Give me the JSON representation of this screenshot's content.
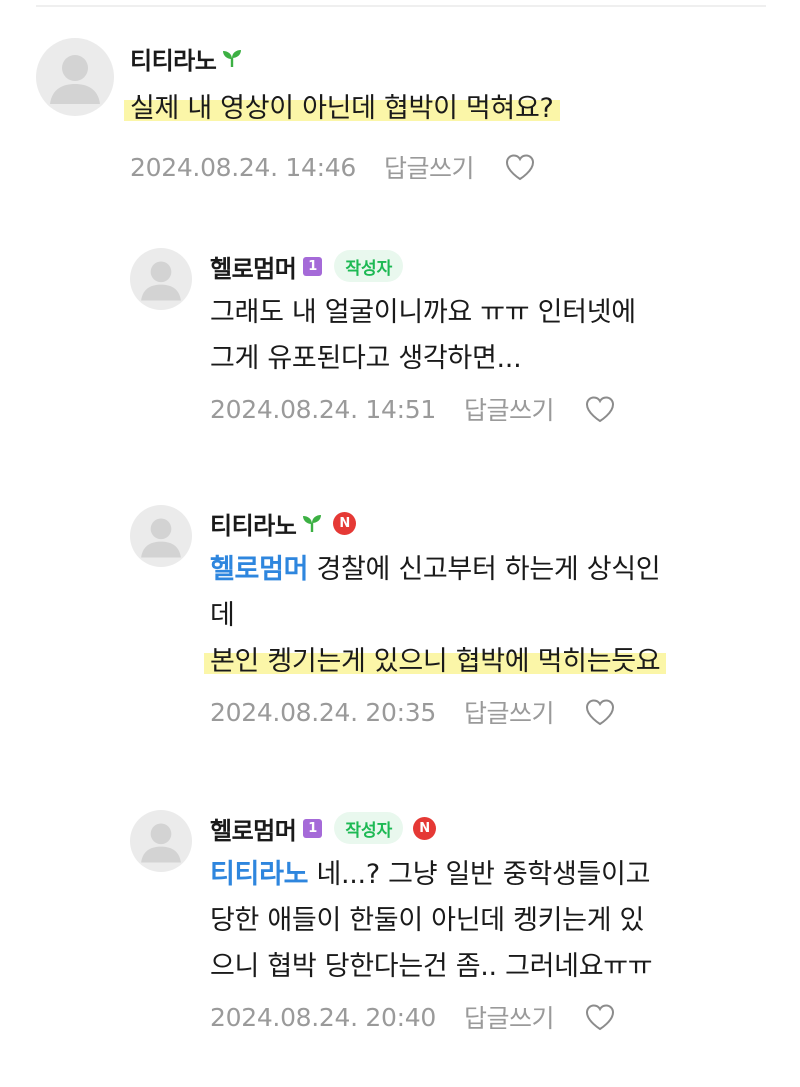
{
  "comments": [
    {
      "author": "티티라노",
      "level_label": "",
      "author_badge": "",
      "new_label": "",
      "lines": [
        {
          "text": "실제 내 영상이 아닌데 협박이 먹혀요?"
        }
      ],
      "date": "2024.08.24. 14:46",
      "reply_label": "답글쓰기"
    },
    {
      "author": "헬로멈머",
      "level_label": "1",
      "author_badge": "작성자",
      "new_label": "",
      "lines": [
        {
          "text": "그래도 내 얼굴이니까요 ㅠㅠ 인터넷에"
        },
        {
          "text": "그게 유포된다고 생각하면..."
        }
      ],
      "date": "2024.08.24. 14:51",
      "reply_label": "답글쓰기"
    },
    {
      "author": "티티라노",
      "level_label": "",
      "author_badge": "",
      "new_label": "N",
      "mention": "헬로멈머",
      "lines": [
        {
          "text": " 경찰에 신고부터 하는게 상식인"
        },
        {
          "text": "데"
        },
        {
          "text": "본인 켕기는게 있으니 협박에 먹히는듯요"
        }
      ],
      "date": "2024.08.24. 20:35",
      "reply_label": "답글쓰기"
    },
    {
      "author": "헬로멈머",
      "level_label": "1",
      "author_badge": "작성자",
      "new_label": "N",
      "mention": "티티라노",
      "lines": [
        {
          "text": " 네...? 그냥 일반 중학생들이고"
        },
        {
          "text": "당한 애들이 한둘이 아닌데 켕키는게 있"
        },
        {
          "text": "으니 협박 당한다는건 좀.. 그러네요ㅠㅠ"
        }
      ],
      "date": "2024.08.24. 20:40",
      "reply_label": "답글쓰기"
    }
  ],
  "icons": {
    "sprout": "sprout-icon",
    "level": "level-icon",
    "new": "new-badge",
    "heart": "heart-icon",
    "avatar": "default-avatar-icon"
  },
  "colors": {
    "mention": "#2e86de",
    "highlight": "#fbf6a8",
    "meta_text": "#9a9a9a",
    "author_badge_text": "#1db954",
    "author_badge_bg": "#e9f8ee",
    "new_badge": "#e53935",
    "level_badge": "#a56ad8"
  }
}
